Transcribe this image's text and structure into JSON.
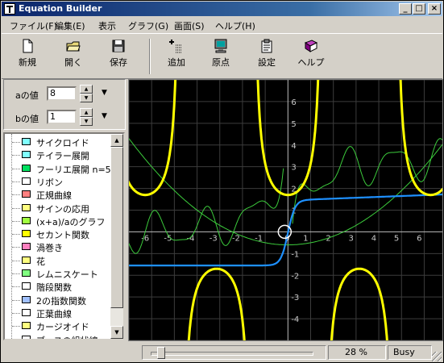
{
  "window": {
    "title": "Equation Builder",
    "controls": [
      "_",
      "□",
      "×"
    ]
  },
  "menu": [
    {
      "label": "ファイル(F)"
    },
    {
      "label": "編集(E)"
    },
    {
      "label": "表示"
    },
    {
      "label": "グラフ(G)"
    },
    {
      "label": "画面(S)"
    },
    {
      "label": "ヘルプ(H)"
    }
  ],
  "toolbar": {
    "new": "新規",
    "open": "開く",
    "save": "保存",
    "add": "追加",
    "origin": "原点",
    "settings": "設定",
    "help": "ヘルプ"
  },
  "params": {
    "a_label": "aの値",
    "a_value": "8",
    "b_label": "bの値",
    "b_value": "1"
  },
  "equations": [
    {
      "label": "サイクロイド",
      "color": "#80ffff"
    },
    {
      "label": "テイラー展開",
      "color": "#80ffff"
    },
    {
      "label": "フーリエ展開 n=5",
      "color": "#00e060"
    },
    {
      "label": "リボン",
      "color": "#ffffff"
    },
    {
      "label": "正規曲線",
      "color": "#ff8080"
    },
    {
      "label": "サインの応用",
      "color": "#ffff80"
    },
    {
      "label": "(x+a)/aのグラフ",
      "color": "#a0ff40"
    },
    {
      "label": "セカント関数",
      "color": "#ffff00"
    },
    {
      "label": "渦巻き",
      "color": "#ff80c0"
    },
    {
      "label": "花",
      "color": "#ffff80"
    },
    {
      "label": "レムニスケート",
      "color": "#80ff80"
    },
    {
      "label": "階段関数",
      "color": "#ffffff"
    },
    {
      "label": "2の指数関数",
      "color": "#a0c0ff"
    },
    {
      "label": "正葉曲線",
      "color": "#ffffff"
    },
    {
      "label": "カージオイド",
      "color": "#ffff80"
    },
    {
      "label": "ブースの組状線",
      "color": "#ffffff"
    }
  ],
  "status": {
    "zoom": "28 %",
    "state": "Busy"
  },
  "chart_data": {
    "type": "line",
    "xlim": [
      -7,
      6.8
    ],
    "ylim": [
      -5,
      7
    ],
    "x_ticks": [
      "-6",
      "-5",
      "-4",
      "-3",
      "-2",
      "-1",
      "0",
      "1",
      "2",
      "3",
      "4",
      "5",
      "6"
    ],
    "y_ticks": [
      "6",
      "5",
      "4",
      "3",
      "2",
      "1",
      "0",
      "-1",
      "-2",
      "-3",
      "-4"
    ],
    "grid": true,
    "series": [
      {
        "color": "#ffff00",
        "kind": "secant"
      },
      {
        "color": "#1e90ff",
        "kind": "step"
      },
      {
        "color": "#3ccc3c",
        "kind": "fourier"
      },
      {
        "color": "#3ccc3c",
        "kind": "parabola"
      }
    ]
  }
}
